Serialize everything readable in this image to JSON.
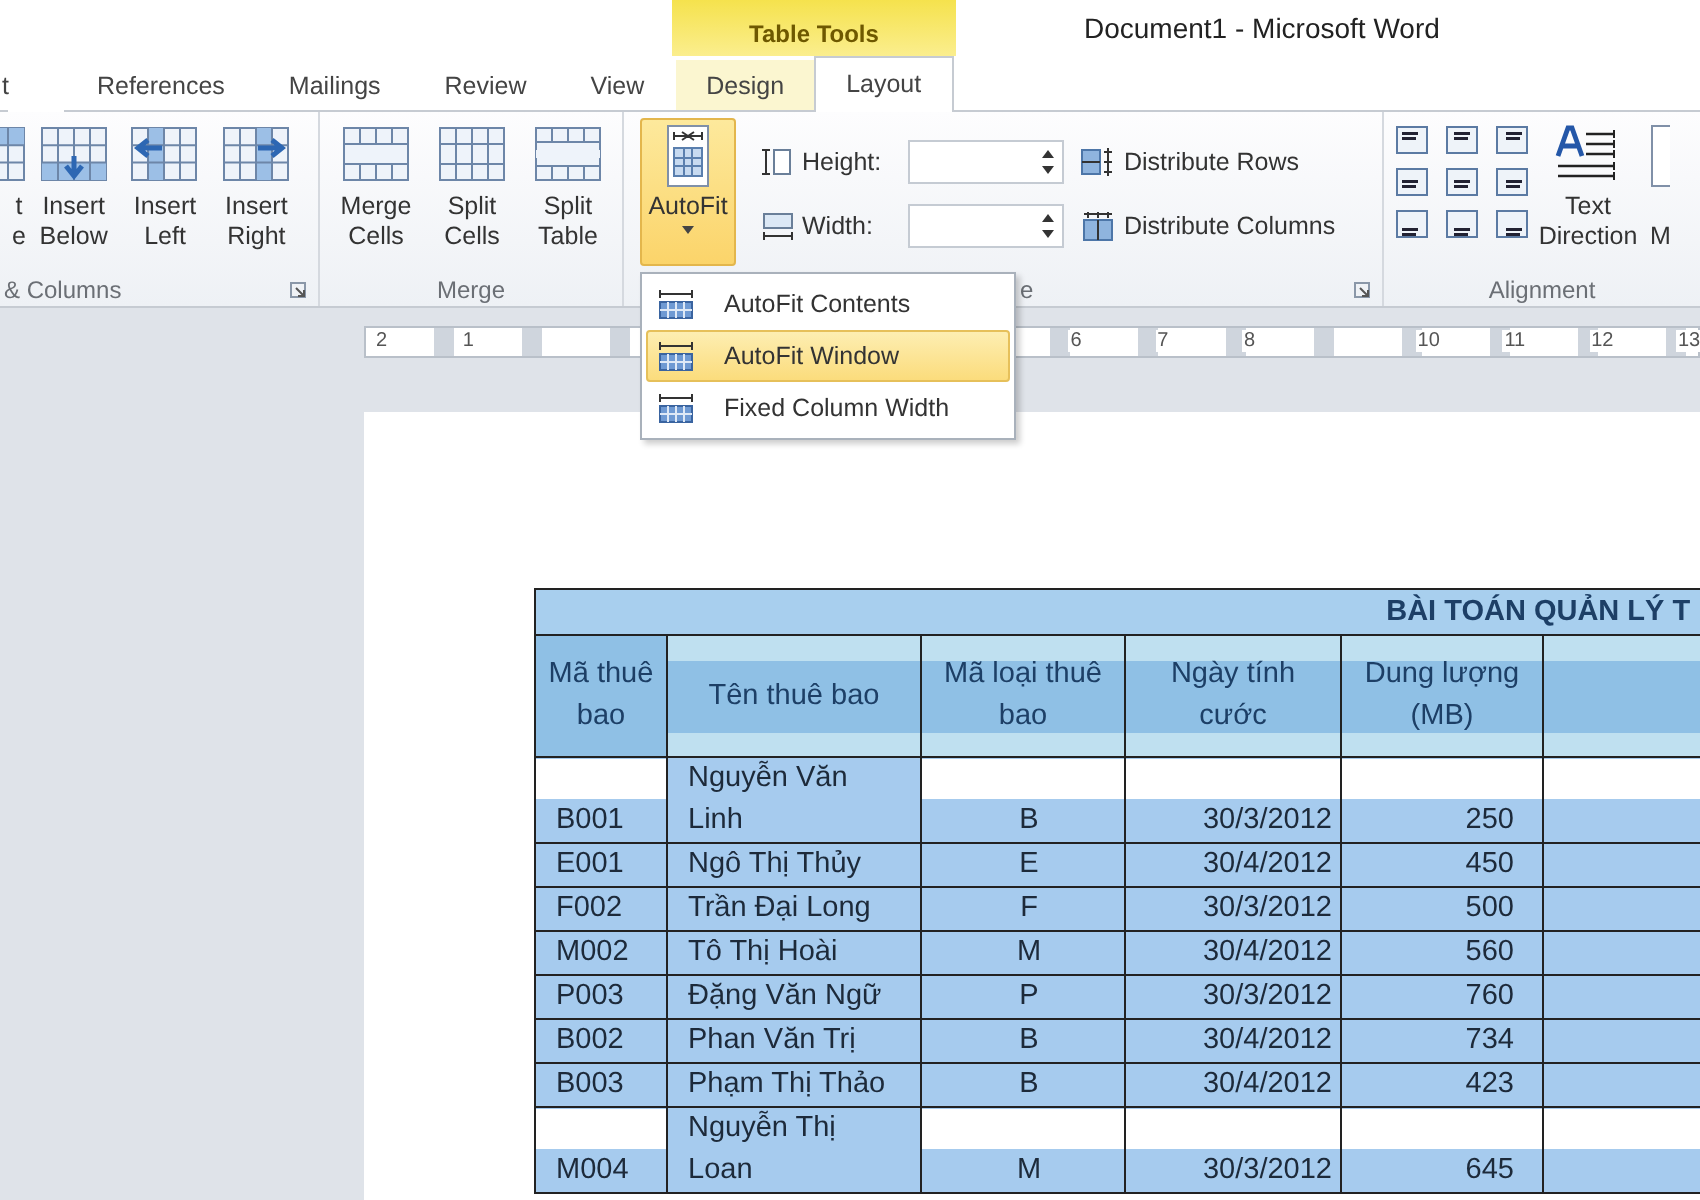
{
  "title_bar": {
    "contextual_tab": "Table Tools",
    "title": "Document1  -  Microsoft Word"
  },
  "tabs": [
    {
      "label": "t",
      "selected": false,
      "contextual": false
    },
    {
      "label": "References",
      "selected": false,
      "contextual": false
    },
    {
      "label": "Mailings",
      "selected": false,
      "contextual": false
    },
    {
      "label": "Review",
      "selected": false,
      "contextual": false
    },
    {
      "label": "View",
      "selected": false,
      "contextual": false
    },
    {
      "label": "Design",
      "selected": false,
      "contextual": true
    },
    {
      "label": "Layout",
      "selected": true,
      "contextual": true
    }
  ],
  "ribbon": {
    "groups": [
      {
        "label": "& Columns",
        "launcher": true,
        "items": [
          {
            "kind": "large",
            "lines": [
              "t",
              "e"
            ]
          },
          {
            "kind": "large",
            "lines": [
              "Insert",
              "Below"
            ]
          },
          {
            "kind": "large",
            "lines": [
              "Insert",
              "Left"
            ]
          },
          {
            "kind": "large",
            "lines": [
              "Insert",
              "Right"
            ]
          }
        ]
      },
      {
        "label": "Merge",
        "launcher": false,
        "items": [
          {
            "kind": "large",
            "lines": [
              "Merge",
              "Cells"
            ]
          },
          {
            "kind": "large",
            "lines": [
              "Split",
              "Cells"
            ]
          },
          {
            "kind": "large",
            "lines": [
              "Split",
              "Table"
            ]
          }
        ]
      },
      {
        "label": "e",
        "launcher": true,
        "items": [
          {
            "kind": "dropdown",
            "lines": [
              "AutoFit"
            ],
            "selected": true
          },
          {
            "kind": "spin",
            "lines": [
              "Height:"
            ]
          },
          {
            "kind": "spin",
            "lines": [
              "Width:"
            ]
          },
          {
            "kind": "small",
            "lines": [
              "Distribute Rows"
            ]
          },
          {
            "kind": "small",
            "lines": [
              "Distribute Columns"
            ]
          }
        ]
      },
      {
        "label": "Alignment",
        "launcher": false,
        "items": [
          {
            "kind": "align"
          },
          {
            "kind": "large",
            "lines": [
              "Text",
              "Direction"
            ]
          },
          {
            "kind": "cut",
            "lines": [
              "M"
            ]
          }
        ]
      }
    ]
  },
  "menu": {
    "items": [
      {
        "label": "AutoFit Contents",
        "selected": false
      },
      {
        "label": "AutoFit Window",
        "selected": true
      },
      {
        "label": "Fixed Column Width",
        "selected": false
      }
    ]
  },
  "ruler": {
    "labels": [
      "2",
      "1",
      "6",
      "7",
      "8",
      "10",
      "11",
      "12",
      "13"
    ]
  },
  "table": {
    "title": "BÀI TOÁN QUẢN LÝ T",
    "columns": [
      "Mã thuê bao",
      "Tên thuê bao",
      "Mã loại thuê bao",
      "Ngày tính cước",
      "Dung lượng (MB)"
    ],
    "rows": [
      {
        "cells": [
          "B001",
          "Nguyễn Văn Linh",
          "B",
          "30/3/2012",
          "250"
        ]
      },
      {
        "cells": [
          "E001",
          "Ngô Thị Thủy",
          "E",
          "30/4/2012",
          "450"
        ]
      },
      {
        "cells": [
          "F002",
          "Trần Đại Long",
          "F",
          "30/3/2012",
          "500"
        ]
      },
      {
        "cells": [
          "M002",
          "Tô Thị Hoài",
          "M",
          "30/4/2012",
          "560"
        ]
      },
      {
        "cells": [
          "P003",
          "Đặng Văn Ngữ",
          "P",
          "30/3/2012",
          "760"
        ]
      },
      {
        "cells": [
          "B002",
          "Phan Văn Trị",
          "B",
          "30/4/2012",
          "734"
        ]
      },
      {
        "cells": [
          "B003",
          "Phạm Thị Thảo",
          "B",
          "30/4/2012",
          "423"
        ]
      },
      {
        "cells": [
          "M004",
          "Nguyễn Thị Loan",
          "M",
          "30/3/2012",
          "645"
        ]
      }
    ]
  }
}
